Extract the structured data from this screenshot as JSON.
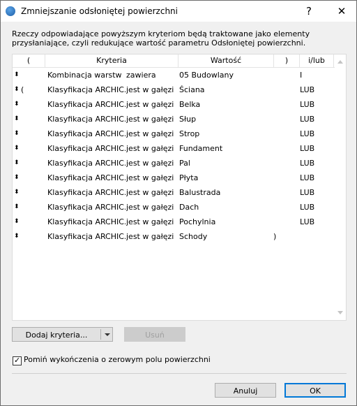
{
  "window": {
    "title": "Zmniejszanie odsłoniętej powierzchni",
    "help_label": "?",
    "close_label": "✕"
  },
  "description": "Rzeczy odpowiadające powyższym kryteriom będą traktowane jako elementy przysłaniające, czyli redukujące wartość parametru Odsłoniętej powierzchni.",
  "table": {
    "headers": {
      "open_paren": "(",
      "criteria": "Kryteria",
      "value": "Wartość",
      "close_paren": ")",
      "andor": "i/lub"
    },
    "rows": [
      {
        "handle": "⬍",
        "open": "",
        "criterion": "Kombinacja warstw",
        "operator": "zawiera",
        "value": "05 Budowlany",
        "close": "",
        "andor": "I"
      },
      {
        "handle": "⬍",
        "open": "(",
        "criterion": "Klasyfikacja ARCHIC...",
        "operator": "jest w gałęzi",
        "value": "Ściana",
        "close": "",
        "andor": "LUB"
      },
      {
        "handle": "⬍",
        "open": "",
        "criterion": "Klasyfikacja ARCHIC...",
        "operator": "jest w gałęzi",
        "value": "Belka",
        "close": "",
        "andor": "LUB"
      },
      {
        "handle": "⬍",
        "open": "",
        "criterion": "Klasyfikacja ARCHIC...",
        "operator": "jest w gałęzi",
        "value": "Słup",
        "close": "",
        "andor": "LUB"
      },
      {
        "handle": "⬍",
        "open": "",
        "criterion": "Klasyfikacja ARCHIC...",
        "operator": "jest w gałęzi",
        "value": "Strop",
        "close": "",
        "andor": "LUB"
      },
      {
        "handle": "⬍",
        "open": "",
        "criterion": "Klasyfikacja ARCHIC...",
        "operator": "jest w gałęzi",
        "value": "Fundament",
        "close": "",
        "andor": "LUB"
      },
      {
        "handle": "⬍",
        "open": "",
        "criterion": "Klasyfikacja ARCHIC...",
        "operator": "jest w gałęzi",
        "value": "Pal",
        "close": "",
        "andor": "LUB"
      },
      {
        "handle": "⬍",
        "open": "",
        "criterion": "Klasyfikacja ARCHIC...",
        "operator": "jest w gałęzi",
        "value": "Płyta",
        "close": "",
        "andor": "LUB"
      },
      {
        "handle": "⬍",
        "open": "",
        "criterion": "Klasyfikacja ARCHIC...",
        "operator": "jest w gałęzi",
        "value": "Balustrada",
        "close": "",
        "andor": "LUB"
      },
      {
        "handle": "⬍",
        "open": "",
        "criterion": "Klasyfikacja ARCHIC...",
        "operator": "jest w gałęzi",
        "value": "Dach",
        "close": "",
        "andor": "LUB"
      },
      {
        "handle": "⬍",
        "open": "",
        "criterion": "Klasyfikacja ARCHIC...",
        "operator": "jest w gałęzi",
        "value": "Pochylnia",
        "close": "",
        "andor": "LUB"
      },
      {
        "handle": "⬍",
        "open": "",
        "criterion": "Klasyfikacja ARCHIC...",
        "operator": "jest w gałęzi",
        "value": "Schody",
        "close": ")",
        "andor": ""
      }
    ]
  },
  "buttons": {
    "add_criteria": "Dodaj kryteria...",
    "remove": "Usuń",
    "cancel": "Anuluj",
    "ok": "OK"
  },
  "checkbox": {
    "label": "Pomiń wykończenia o zerowym polu powierzchni",
    "checked": true,
    "check_glyph": "✓"
  }
}
